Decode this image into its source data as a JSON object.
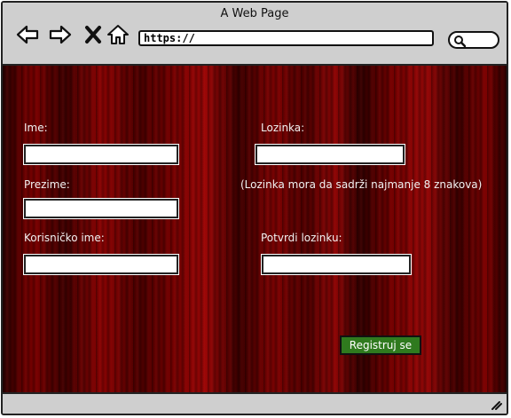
{
  "window": {
    "title": "A Web Page"
  },
  "toolbar": {
    "back_icon": "arrow-left",
    "forward_icon": "arrow-right",
    "stop_icon": "x",
    "home_icon": "home",
    "url": "https://",
    "search_icon": "search"
  },
  "form": {
    "first_name_label": "Ime:",
    "first_name_value": "",
    "last_name_label": "Prezime:",
    "last_name_value": "",
    "username_label": "Korisničko ime:",
    "username_value": "",
    "password_label": "Lozinka:",
    "password_value": "",
    "password_hint": "(Lozinka mora da sadrži najmanje 8 znakova)",
    "confirm_label": "Potvrdi lozinku:",
    "confirm_value": "",
    "submit_label": "Registruj se",
    "submit_color": "#2f7a1e",
    "background_color": "#7a0000"
  }
}
